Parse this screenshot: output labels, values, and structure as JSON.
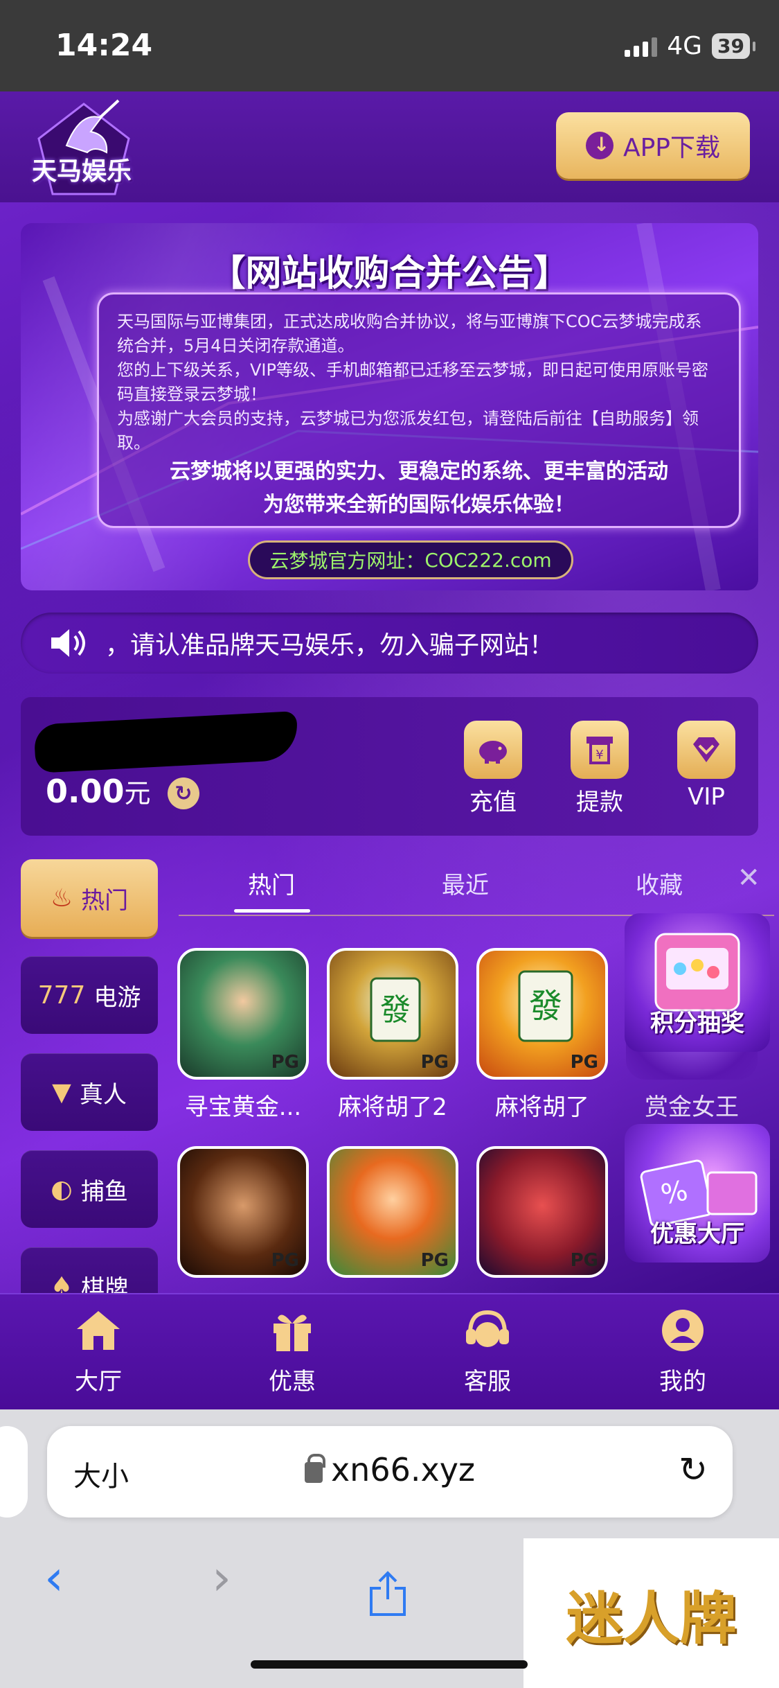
{
  "status_bar": {
    "time": "14:24",
    "network": "4G",
    "battery": "39"
  },
  "header": {
    "logo_text": "天马娱乐",
    "app_download": "APP下载"
  },
  "banner": {
    "title": "【网站收购合并公告】",
    "lines": [
      "天马国际与亚博集团，正式达成收购合并协议，将与亚博旗下COC云梦城完成系",
      "统合并，5月4日关闭存款通道。",
      "您的上下级关系，VIP等级、手机邮箱都已迁移至云梦城，即日起可使用原账号密",
      "码直接登录云梦城！",
      "为感谢广大会员的支持，云梦城已为您派发红包，请登陆后前往【自助服务】领",
      "取。"
    ],
    "emphasis": [
      "云梦城将以更强的实力、更稳定的系统、更丰富的活动",
      "为您带来全新的国际化娱乐体验！"
    ],
    "official_label": "云梦城官方网址：",
    "official_url": "COC222.com"
  },
  "marquee": {
    "text": "，请认准品牌天马娱乐，勿入骗子网站！"
  },
  "wallet": {
    "balance": "0.00",
    "unit": "元",
    "actions": [
      {
        "label": "充值",
        "icon": "piggy-bank-icon"
      },
      {
        "label": "提款",
        "icon": "withdraw-icon"
      },
      {
        "label": "VIP",
        "icon": "vip-diamond-icon"
      }
    ]
  },
  "categories": [
    {
      "label": "热门",
      "icon": "flame-icon"
    },
    {
      "label": "电游",
      "icon": "slot-777-icon"
    },
    {
      "label": "真人",
      "icon": "tuxedo-icon"
    },
    {
      "label": "捕鱼",
      "icon": "fish-icon"
    },
    {
      "label": "棋牌",
      "icon": "cards-icon"
    }
  ],
  "tabs": [
    "热门",
    "最近",
    "收藏"
  ],
  "games": [
    {
      "name": "寻宝黄金...",
      "badge": "PG"
    },
    {
      "name": "麻将胡了2",
      "badge": "PG"
    },
    {
      "name": "麻将胡了",
      "badge": "PG"
    },
    {
      "name": "赏金女王",
      "badge": ""
    },
    {
      "name": "",
      "badge": "PG"
    },
    {
      "name": "",
      "badge": "PG"
    },
    {
      "name": "",
      "badge": "PG"
    }
  ],
  "promos": [
    "积分抽奖",
    "优惠大厅"
  ],
  "tabbar": [
    "大厅",
    "优惠",
    "客服",
    "我的"
  ],
  "browser": {
    "aa": "大小",
    "url": "xn66.xyz"
  },
  "watermark": "迷人牌",
  "colors": {
    "gold": "#e8b55e",
    "purple": "#5a16b0",
    "green_url": "#9df36b"
  }
}
